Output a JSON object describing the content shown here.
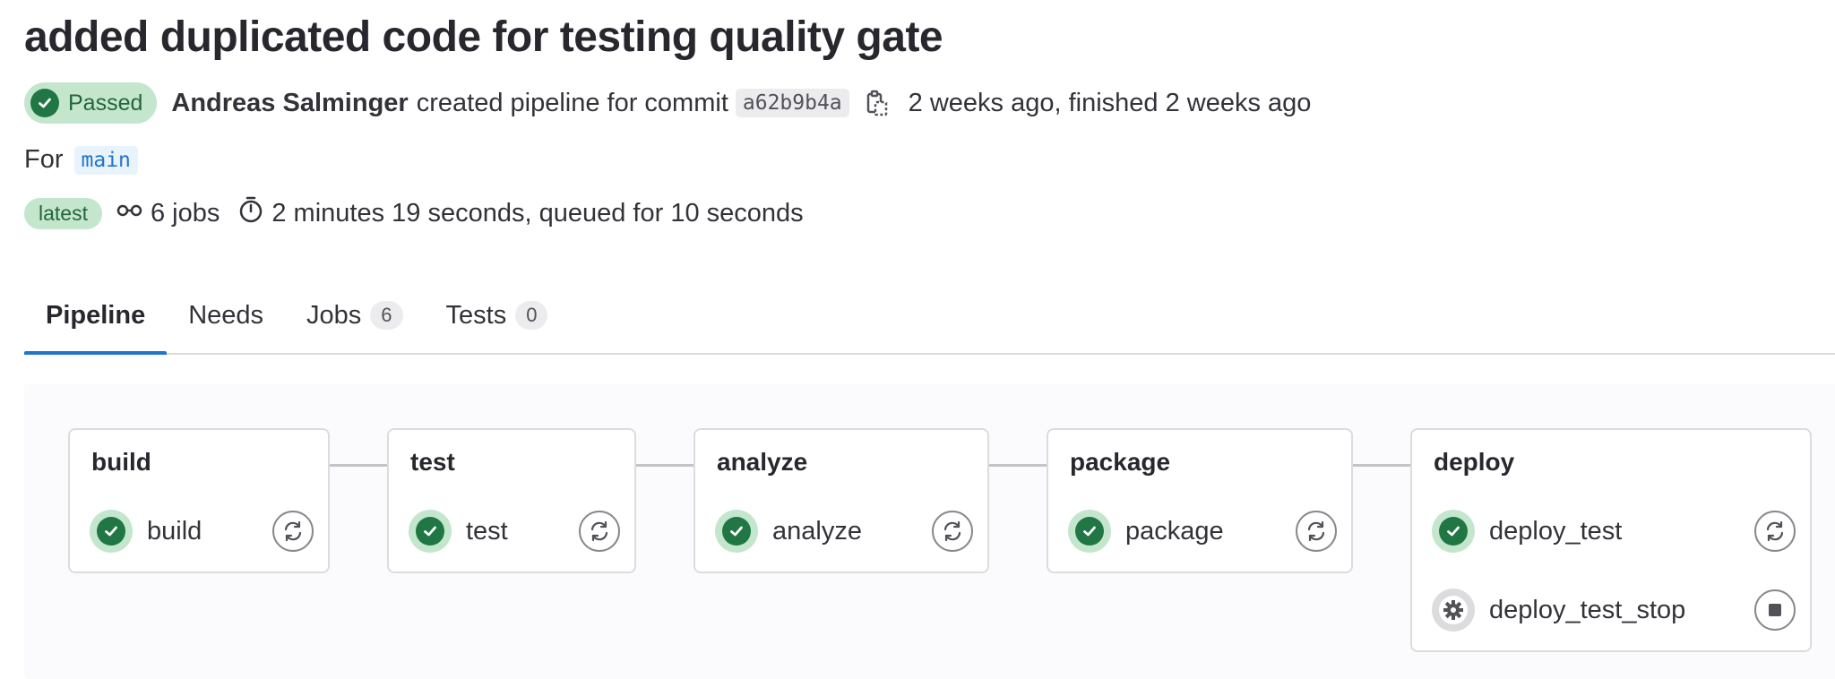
{
  "pipeline": {
    "title": "added duplicated code for testing quality gate",
    "status": "Passed",
    "author": "Andreas Salminger",
    "action_text": "created pipeline for commit",
    "commit_sha": "a62b9b4a",
    "time_text": "2 weeks ago, finished 2 weeks ago",
    "for_label": "For",
    "ref": "main",
    "latest_badge": "latest",
    "jobs_count_text": "6 jobs",
    "duration_text": "2 minutes 19 seconds, queued for 10 seconds"
  },
  "tabs": [
    {
      "label": "Pipeline",
      "active": true
    },
    {
      "label": "Needs"
    },
    {
      "label": "Jobs",
      "count": "6"
    },
    {
      "label": "Tests",
      "count": "0"
    }
  ],
  "stages": [
    {
      "name": "build",
      "jobs": [
        {
          "name": "build",
          "status": "success",
          "action": "retry"
        }
      ]
    },
    {
      "name": "test",
      "jobs": [
        {
          "name": "test",
          "status": "success",
          "action": "retry"
        }
      ]
    },
    {
      "name": "analyze",
      "jobs": [
        {
          "name": "analyze",
          "status": "success",
          "action": "retry"
        }
      ]
    },
    {
      "name": "package",
      "jobs": [
        {
          "name": "package",
          "status": "success",
          "action": "retry"
        }
      ]
    },
    {
      "name": "deploy",
      "jobs": [
        {
          "name": "deploy_test",
          "status": "success",
          "action": "retry"
        },
        {
          "name": "deploy_test_stop",
          "status": "manual",
          "action": "stop"
        }
      ]
    }
  ],
  "icons": {
    "status_success": "check-circle-icon",
    "status_manual": "gear-icon",
    "retry": "retry-icon",
    "stop": "stop-icon",
    "copy": "copy-icon",
    "jobs": "pipeline-icon",
    "duration": "timer-icon"
  },
  "colors": {
    "success_bg": "#c3e6cd",
    "success_fg": "#217645",
    "link_blue": "#1f75cb"
  }
}
